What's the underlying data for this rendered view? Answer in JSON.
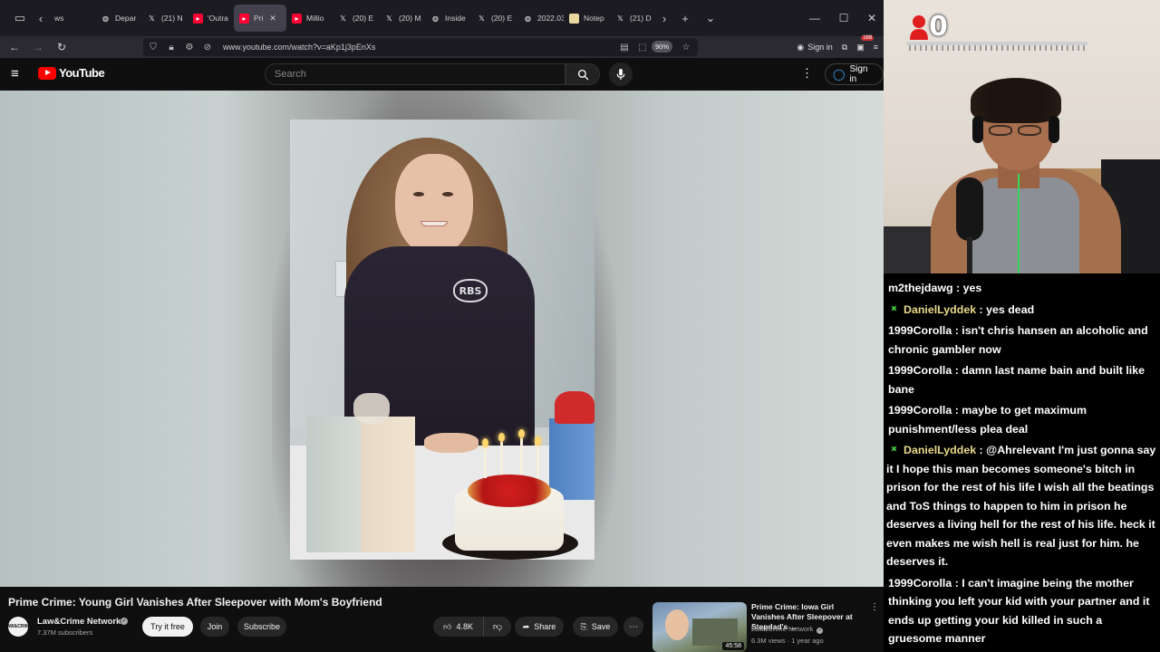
{
  "browser": {
    "tabs": [
      {
        "label": "ws",
        "icon": "back-arrow-icon"
      },
      {
        "label": "Depar",
        "icon": "globe-icon"
      },
      {
        "label": "(21) N",
        "icon": "x-logo-icon"
      },
      {
        "label": "'Outra",
        "icon": "youtube-icon"
      },
      {
        "label": "Pri",
        "icon": "youtube-icon",
        "active": true
      },
      {
        "label": "Millio",
        "icon": "youtube-icon"
      },
      {
        "label": "(20) E",
        "icon": "x-logo-icon"
      },
      {
        "label": "(20) M",
        "icon": "x-logo-icon"
      },
      {
        "label": "Inside",
        "icon": "globe-icon"
      },
      {
        "label": "(20) E",
        "icon": "x-logo-icon"
      },
      {
        "label": "2022.03.1",
        "icon": "globe-icon"
      },
      {
        "label": "Notep",
        "icon": "notepad-icon"
      },
      {
        "label": "(21) D",
        "icon": "x-logo-icon"
      }
    ],
    "url": "www.youtube.com/watch?v=aKp1j3pEnXs",
    "zoom": "90%",
    "signin_label": "Sign in",
    "notification_count": "168"
  },
  "youtube": {
    "logo_text": "YouTube",
    "search_placeholder": "Search",
    "signin_label": "Sign in",
    "video": {
      "title": "Prime Crime: Young Girl Vanishes After Sleepover with Mom's Boyfriend",
      "channel": "Law&Crime Network",
      "channel_avatar_text": "LAW&CRIME",
      "subscribers": "7.37M subscribers",
      "try_label": "Try it free",
      "join_label": "Join",
      "subscribe_label": "Subscribe",
      "likes": "4.8K",
      "share_label": "Share",
      "save_label": "Save"
    },
    "recommendation": {
      "title": "Prime Crime: Iowa Girl Vanishes After Sleepover at Stepdad's ...",
      "channel": "Law&Crime Network",
      "meta": "6.3M views · 1 year ago",
      "duration": "45:58"
    }
  },
  "stream": {
    "overlay_count": "0"
  },
  "chat": {
    "messages": [
      {
        "user": "m2thejdawg",
        "text": "yes",
        "vip": false
      },
      {
        "user": "DanielLyddek",
        "text": "yes dead",
        "vip": true
      },
      {
        "user": "1999Corolla",
        "text": "isn't chris hansen an alcoholic and chronic gambler now",
        "vip": false
      },
      {
        "user": "1999Corolla",
        "text": "damn last name bain and built like bane",
        "vip": false
      },
      {
        "user": "1999Corolla",
        "text": "maybe to get maximum punishment/less plea deal",
        "vip": false
      },
      {
        "user": "DanielLyddek",
        "text": "@Ahrelevant I'm just gonna say it I hope this man becomes someone's bitch in prison for the rest of his life I wish all the beatings and ToS things to happen to him in prison he deserves a living hell for the rest of his life. heck it even makes me wish hell is real just for him. he deserves it.",
        "vip": true
      },
      {
        "user": "1999Corolla",
        "text": "I can't imagine being the mother thinking you left your kid with your partner and it ends up getting your kid killed in such a gruesome manner",
        "vip": false
      }
    ]
  }
}
